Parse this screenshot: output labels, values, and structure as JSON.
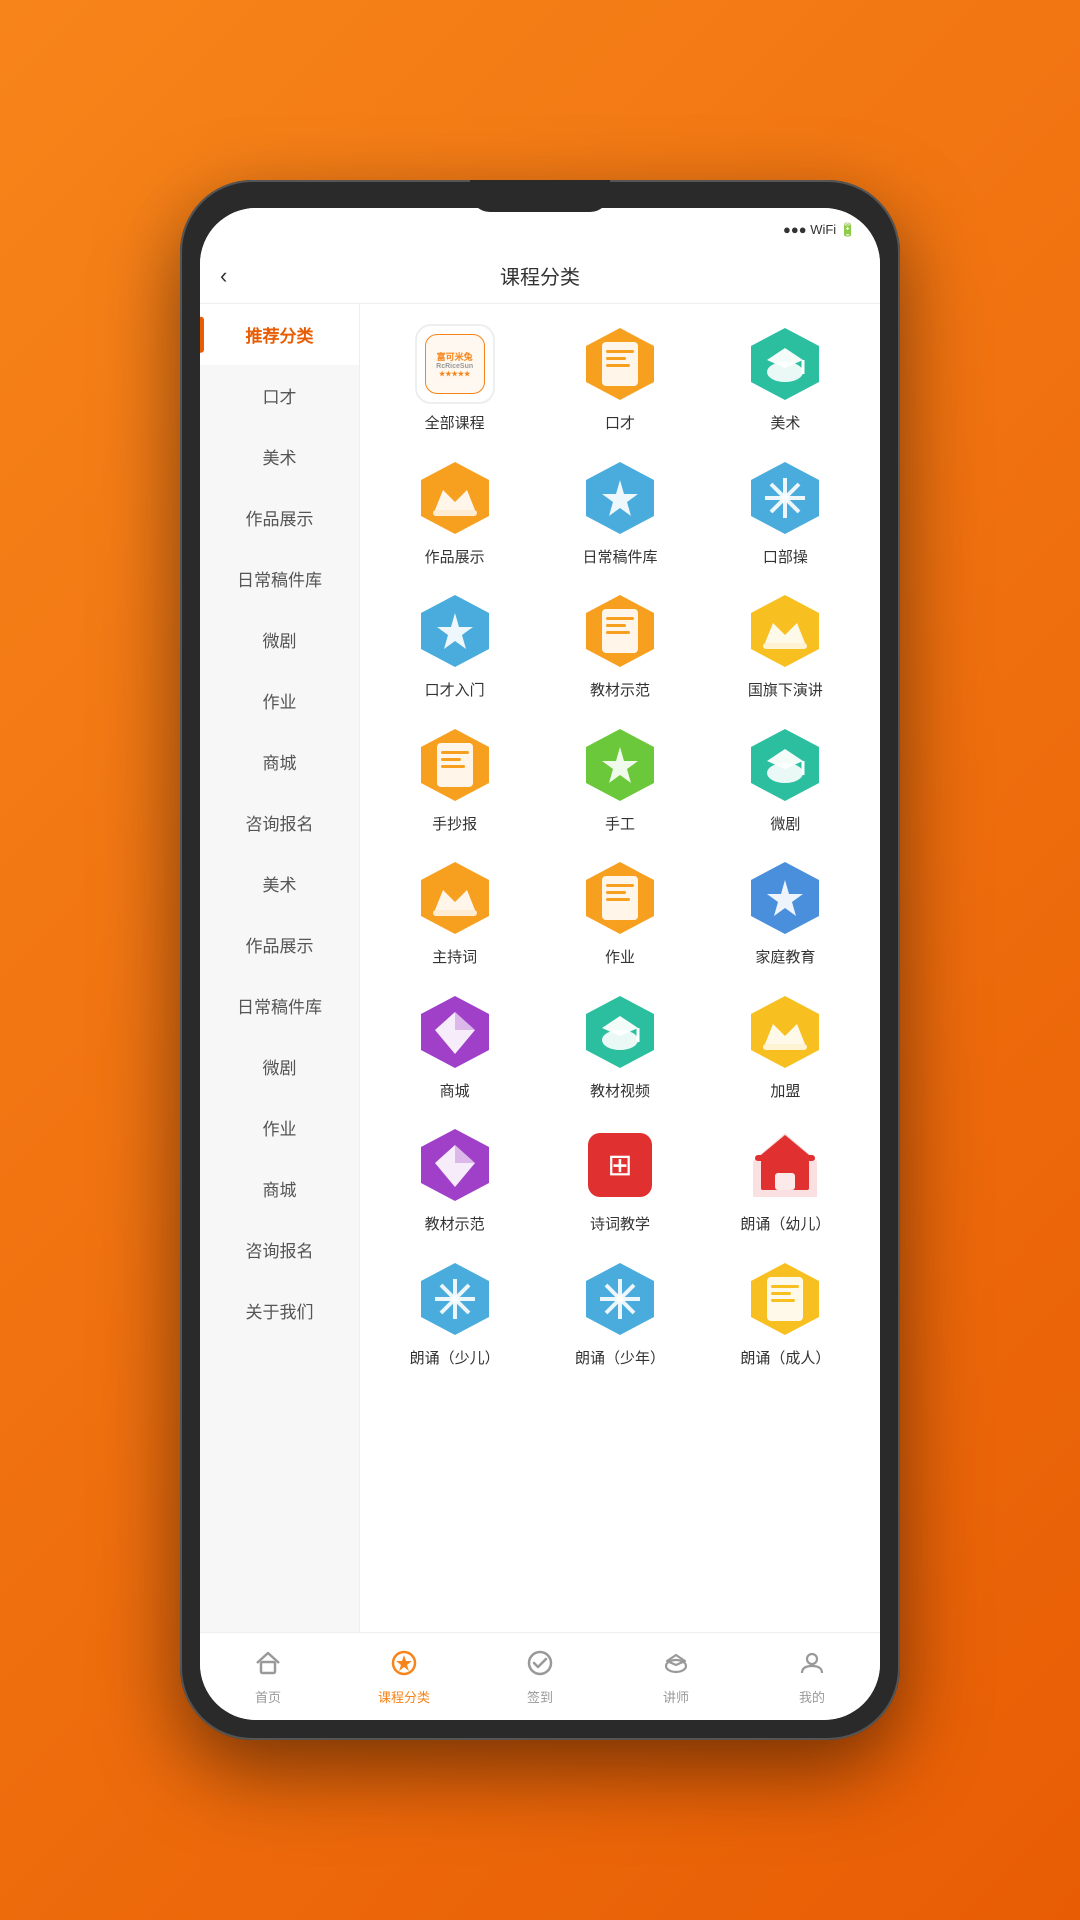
{
  "background": "#f7841a",
  "header": {
    "title": "课程分类",
    "back_icon": "‹"
  },
  "sidebar": {
    "items": [
      {
        "label": "推荐分类",
        "active": true
      },
      {
        "label": "口才",
        "active": false
      },
      {
        "label": "美术",
        "active": false
      },
      {
        "label": "作品展示",
        "active": false
      },
      {
        "label": "日常稿件库",
        "active": false
      },
      {
        "label": "微剧",
        "active": false
      },
      {
        "label": "作业",
        "active": false
      },
      {
        "label": "商城",
        "active": false
      },
      {
        "label": "咨询报名",
        "active": false
      },
      {
        "label": "美术",
        "active": false
      },
      {
        "label": "作品展示",
        "active": false
      },
      {
        "label": "日常稿件库",
        "active": false
      },
      {
        "label": "微剧",
        "active": false
      },
      {
        "label": "作业",
        "active": false
      },
      {
        "label": "商城",
        "active": false
      },
      {
        "label": "咨询报名",
        "active": false
      },
      {
        "label": "关于我们",
        "active": false
      }
    ]
  },
  "grid": {
    "items": [
      {
        "name": "全部课程",
        "type": "logo",
        "color": "#f7841a",
        "emoji": "🏠"
      },
      {
        "name": "口才",
        "type": "hex",
        "color": "#f7a020",
        "emoji": "📋"
      },
      {
        "name": "美术",
        "type": "hex",
        "color": "#2bbfa0",
        "emoji": "🎓"
      },
      {
        "name": "作品展示",
        "type": "hex",
        "color": "#f7a020",
        "emoji": "👑"
      },
      {
        "name": "日常稿件库",
        "type": "hex",
        "color": "#4aacdc",
        "emoji": "⭐"
      },
      {
        "name": "口部操",
        "type": "hex",
        "color": "#4aacdc",
        "emoji": "❄"
      },
      {
        "name": "口才入门",
        "type": "hex",
        "color": "#4aacdc",
        "emoji": "⭐"
      },
      {
        "name": "教材示范",
        "type": "hex",
        "color": "#f7a020",
        "emoji": "📋"
      },
      {
        "name": "国旗下演讲",
        "type": "hex",
        "color": "#f7c020",
        "emoji": "👑"
      },
      {
        "name": "手抄报",
        "type": "hex",
        "color": "#f7a020",
        "emoji": "📋"
      },
      {
        "name": "手工",
        "type": "hex",
        "color": "#6ac83a",
        "emoji": "⭐"
      },
      {
        "name": "微剧",
        "type": "hex",
        "color": "#2bbfa0",
        "emoji": "🎓"
      },
      {
        "name": "主持词",
        "type": "hex",
        "color": "#f7a020",
        "emoji": "👑"
      },
      {
        "name": "作业",
        "type": "hex",
        "color": "#f7a020",
        "emoji": "📋"
      },
      {
        "name": "家庭教育",
        "type": "hex",
        "color": "#4a8fdc",
        "emoji": "⭐"
      },
      {
        "name": "商城",
        "type": "hex",
        "color": "#a040c8",
        "emoji": "💎"
      },
      {
        "name": "教材视频",
        "type": "hex",
        "color": "#2bbfa0",
        "emoji": "🎓"
      },
      {
        "name": "加盟",
        "type": "hex",
        "color": "#f7c020",
        "emoji": "👑"
      },
      {
        "name": "教材示范",
        "type": "hex",
        "color": "#a040c8",
        "emoji": "💎"
      },
      {
        "name": "诗词教学",
        "type": "square",
        "color": "#e03030",
        "emoji": "⊞"
      },
      {
        "name": "朗诵（幼儿）",
        "type": "house",
        "color": "#e03030",
        "emoji": "🏠"
      },
      {
        "name": "朗诵（少儿）",
        "type": "hex",
        "color": "#4aacdc",
        "emoji": "❄"
      },
      {
        "name": "朗诵（少年）",
        "type": "hex",
        "color": "#4aacdc",
        "emoji": "❄"
      },
      {
        "name": "朗诵（成人）",
        "type": "hex",
        "color": "#f7c020",
        "emoji": "📋"
      }
    ]
  },
  "tabs": [
    {
      "label": "首页",
      "icon": "🏠",
      "active": false
    },
    {
      "label": "课程分类",
      "icon": "⭐",
      "active": true
    },
    {
      "label": "签到",
      "icon": "✅",
      "active": false
    },
    {
      "label": "讲师",
      "icon": "🎓",
      "active": false
    },
    {
      "label": "我的",
      "icon": "👤",
      "active": false
    }
  ]
}
